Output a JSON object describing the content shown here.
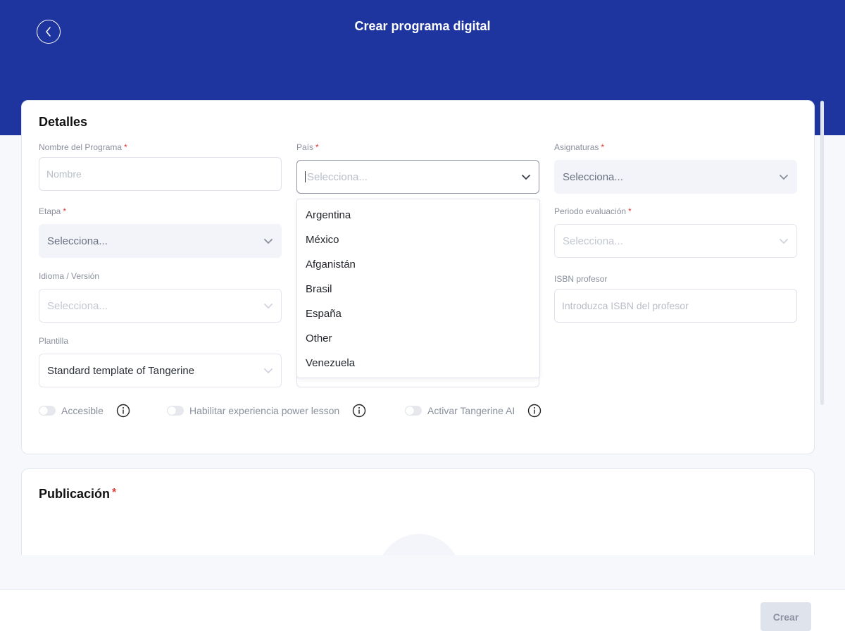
{
  "header": {
    "title": "Crear programa digital",
    "background": "#1e35a0"
  },
  "detalles": {
    "title": "Detalles",
    "fields": {
      "nombre": {
        "label": "Nombre del Programa",
        "placeholder": "Nombre"
      },
      "pais": {
        "label": "País",
        "placeholder": "Selecciona..."
      },
      "asignaturas": {
        "label": "Asignaturas",
        "placeholder": "Selecciona..."
      },
      "etapa": {
        "label": "Etapa",
        "placeholder": "Selecciona..."
      },
      "periodo": {
        "label": "Periodo evaluación",
        "placeholder": "Selecciona..."
      },
      "idioma": {
        "label": "Idioma / Versión",
        "placeholder": "Selecciona..."
      },
      "isbn_profesor": {
        "label": "ISBN profesor",
        "placeholder": "Introduzca ISBN del profesor"
      },
      "plantilla": {
        "label": "Plantilla",
        "value": "Standard template of Tangerine"
      }
    },
    "required_mark": "*",
    "pais_options": [
      "Argentina",
      "México",
      "Afganistán",
      "Brasil",
      "España",
      "Other",
      "Venezuela"
    ],
    "toggles": [
      {
        "label": "Accesible",
        "on": false
      },
      {
        "label": "Habilitar experiencia power lesson",
        "on": false
      },
      {
        "label": "Activar Tangerine AI",
        "on": false
      }
    ]
  },
  "publicacion": {
    "title": "Publicación",
    "required_mark": "*"
  },
  "footer": {
    "create_label": "Crear"
  },
  "icons": {
    "back": "chevron-left-circle-icon",
    "dropdown": "chevron-down-icon",
    "info": "info-circle-icon"
  }
}
